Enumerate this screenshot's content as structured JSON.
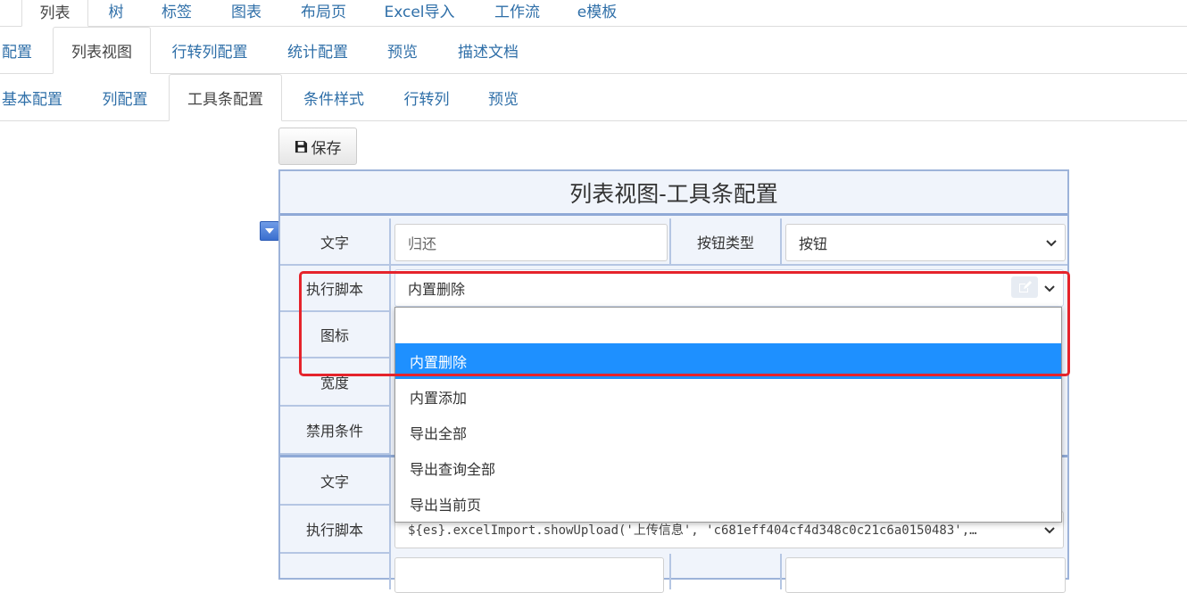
{
  "tabs_top": [
    "列表",
    "树",
    "标签",
    "图表",
    "布局页",
    "Excel导入",
    "工作流",
    "e模板"
  ],
  "tabs_second": [
    "配置",
    "列表视图",
    "行转列配置",
    "统计配置",
    "预览",
    "描述文档"
  ],
  "tabs_third": [
    "基本配置",
    "列配置",
    "工具条配置",
    "条件样式",
    "行转列",
    "预览"
  ],
  "toolbar": {
    "save_label": "保存"
  },
  "panel": {
    "title": "列表视图-工具条配置",
    "item1": {
      "text_label": "文字",
      "text_placeholder": "归还",
      "button_type_label": "按钮类型",
      "button_type_value": "按钮",
      "script_label": "执行脚本",
      "script_value": "内置删除",
      "icon_label": "图标",
      "width_label": "宽度",
      "disable_label": "禁用条件"
    },
    "item2": {
      "text_label": "文字",
      "script_label": "执行脚本",
      "script_value": "${es}.excelImport.showUpload('上传信息', 'c681eff404cf4d348c0c21c6a0150483',…"
    }
  },
  "dropdown": {
    "options": [
      "",
      "内置删除",
      "内置添加",
      "导出全部",
      "导出查询全部",
      "导出当前页"
    ],
    "selected": "内置删除"
  },
  "colors": {
    "accent": "#1e90ff",
    "highlight": "#e5232b",
    "link": "#2f6fa8"
  }
}
